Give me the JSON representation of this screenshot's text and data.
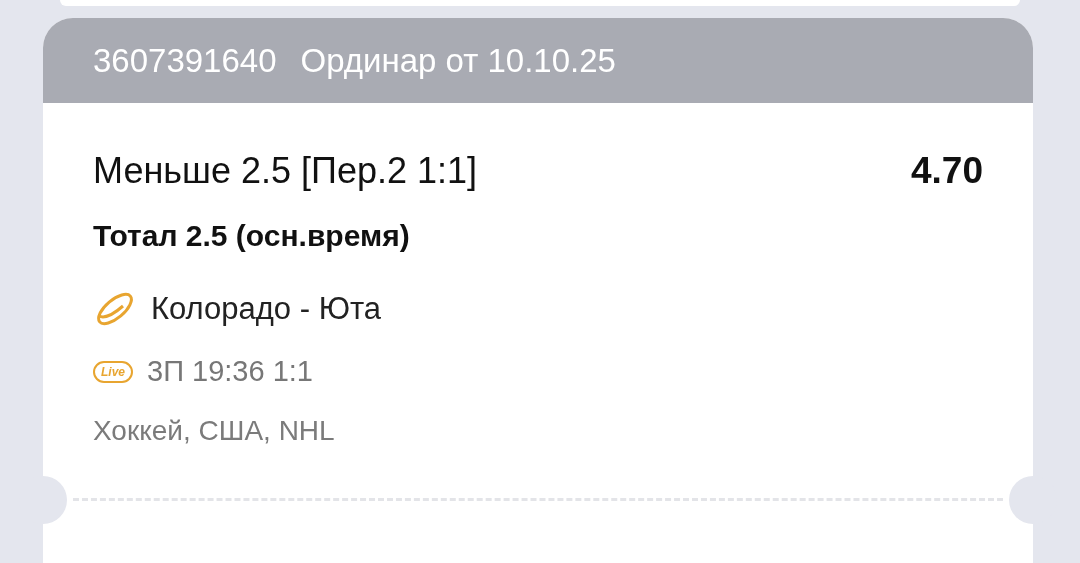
{
  "bet": {
    "number": "3607391640",
    "title": "Ординар от 10.10.25",
    "selection": "Меньше 2.5 [Пер.2 1:1]",
    "odds": "4.70",
    "market": "Тотал 2.5 (осн.время)",
    "event": "Колорадо - Юта",
    "live": true,
    "live_label": "Live",
    "status": "3П 19:36 1:1",
    "league": "Хоккей, США, NHL"
  }
}
